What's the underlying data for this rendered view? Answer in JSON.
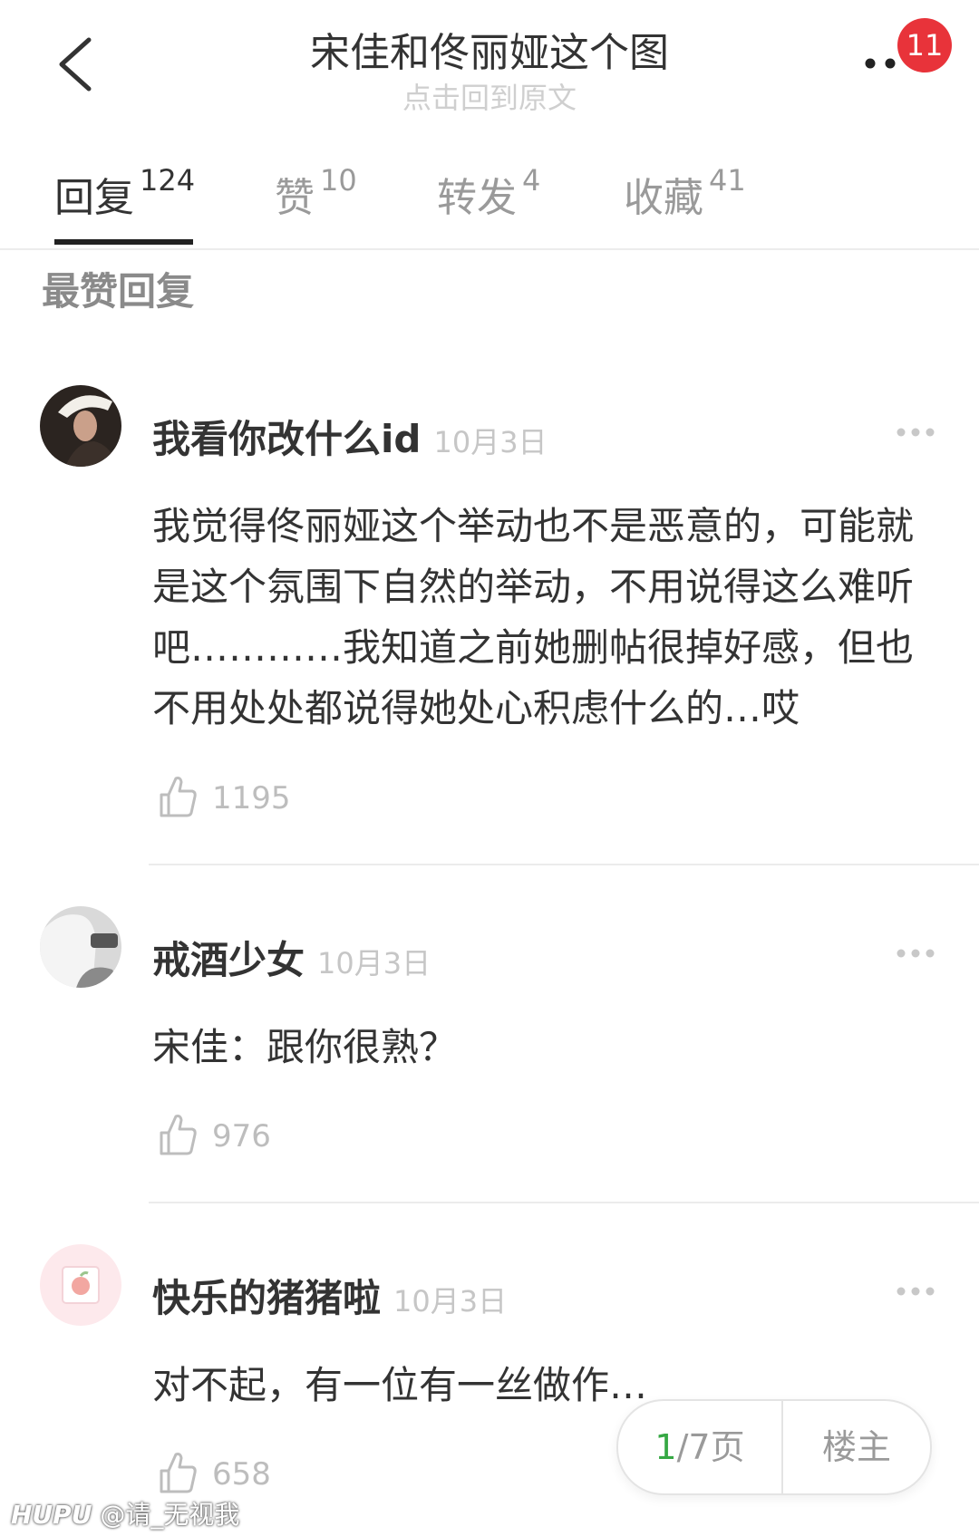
{
  "header": {
    "title": "宋佳和佟丽娅这个图",
    "subtitle": "点击回到原文",
    "notification_count": "11"
  },
  "tabs": [
    {
      "label": "回复",
      "count": "124"
    },
    {
      "label": "赞",
      "count": "10"
    },
    {
      "label": "转发",
      "count": "4"
    },
    {
      "label": "收藏",
      "count": "41"
    }
  ],
  "section_title": "最赞回复",
  "comments": [
    {
      "username": "我看你改什么id",
      "date": "10月3日",
      "text": "我觉得佟丽娅这个举动也不是恶意的，可能就是这个氛围下自然的举动，不用说得这么难听吧…………我知道之前她删帖很掉好感，但也不用处处都说得她处心积虑什么的…哎",
      "likes": "1195"
    },
    {
      "username": "戒酒少女",
      "date": "10月3日",
      "text": "宋佳：跟你很熟？",
      "likes": "976"
    },
    {
      "username": "快乐的猪猪啦",
      "date": "10月3日",
      "text": "对不起，有一位有一丝做作…",
      "likes": "658"
    }
  ],
  "pager": {
    "current": "1",
    "total": "/7页",
    "op_label": "楼主"
  },
  "watermark": {
    "brand": "HUPU",
    "handle": "@请_无视我"
  },
  "colors": {
    "badge": "#e8333a",
    "page_current": "#36a844",
    "muted": "#9a9a9a"
  }
}
